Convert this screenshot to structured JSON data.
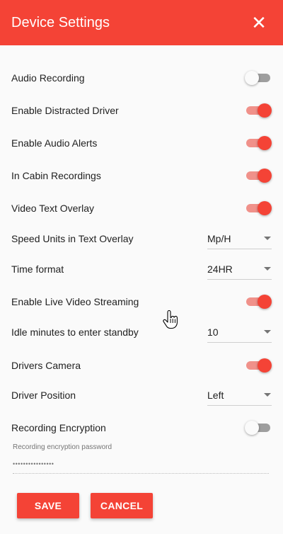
{
  "header": {
    "title": "Device Settings",
    "close_icon": "close-icon"
  },
  "settings": [
    {
      "label": "Audio Recording",
      "type": "toggle",
      "on": false
    },
    {
      "label": "Enable Distracted Driver",
      "type": "toggle",
      "on": true
    },
    {
      "label": "Enable Audio Alerts",
      "type": "toggle",
      "on": true
    },
    {
      "label": "In Cabin Recordings",
      "type": "toggle",
      "on": true
    },
    {
      "label": "Video Text Overlay",
      "type": "toggle",
      "on": true
    },
    {
      "label": "Speed Units in Text Overlay",
      "type": "select",
      "value": "Mp/H"
    },
    {
      "label": "Time format",
      "type": "select",
      "value": "24HR"
    },
    {
      "label": "Enable Live Video Streaming",
      "type": "toggle",
      "on": true
    },
    {
      "label": "Idle minutes to enter standby",
      "type": "select",
      "value": "10"
    },
    {
      "label": "Drivers Camera",
      "type": "toggle",
      "on": true
    },
    {
      "label": "Driver Position",
      "type": "select",
      "value": "Left"
    },
    {
      "label": "Recording Encryption",
      "type": "toggle",
      "on": false
    }
  ],
  "password": {
    "label": "Recording encryption password",
    "masked_value": "••••••••••••••••"
  },
  "buttons": {
    "save": "SAVE",
    "cancel": "CANCEL"
  },
  "colors": {
    "accent": "#f44336",
    "track_on": "#f0918a",
    "track_off": "#9e9e9e"
  }
}
